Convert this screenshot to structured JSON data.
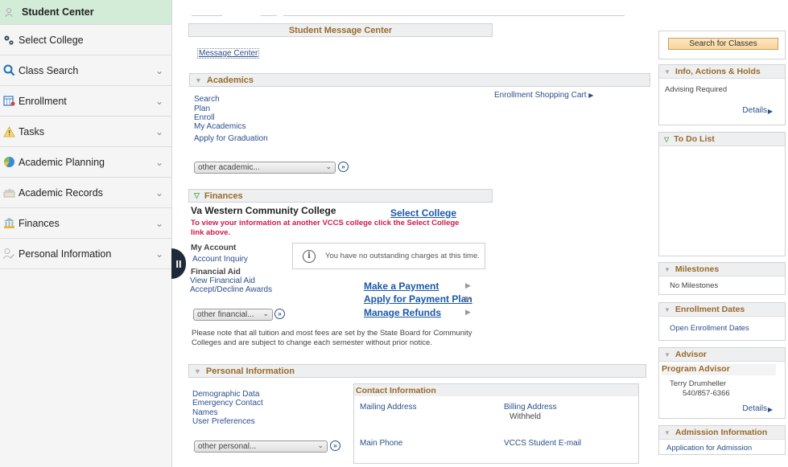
{
  "sidebar": {
    "items": [
      {
        "label": "Student Center",
        "icon": "person-icon",
        "active": true
      },
      {
        "label": "Select College",
        "icon": "gears-icon"
      },
      {
        "label": "Class Search",
        "icon": "search-icon",
        "expandable": true
      },
      {
        "label": "Enrollment",
        "icon": "calendar-icon",
        "expandable": true
      },
      {
        "label": "Tasks",
        "icon": "warning-icon",
        "expandable": true
      },
      {
        "label": "Academic Planning",
        "icon": "globe-icon",
        "expandable": true
      },
      {
        "label": "Academic Records",
        "icon": "records-icon",
        "expandable": true
      },
      {
        "label": "Finances",
        "icon": "bank-icon",
        "expandable": true
      },
      {
        "label": "Personal Information",
        "icon": "user-edit-icon",
        "expandable": true
      }
    ],
    "collapse_handle": "II"
  },
  "message_center": {
    "header": "Student Message Center",
    "link": "Message Center"
  },
  "academics": {
    "header": "Academics",
    "links": [
      "Search",
      "Plan",
      "Enroll",
      "My Academics",
      "Apply for Graduation"
    ],
    "shopping_cart": "Enrollment Shopping Cart",
    "dropdown": "other academic..."
  },
  "finances": {
    "header": "Finances",
    "college": "Va Western Community College",
    "select_college": "Select College",
    "warning": "To view your information at another VCCS college click the Select College link above.",
    "my_account_label": "My Account",
    "account_inquiry": "Account Inquiry",
    "financial_aid_label": "Financial Aid",
    "view_financial_aid": "View Financial Aid",
    "accept_decline": "Accept/Decline Awards",
    "notice": "You have no outstanding charges at this time.",
    "actions": [
      "Make a Payment",
      "Apply for Payment Plan",
      "Manage Refunds"
    ],
    "dropdown": "other financial...",
    "footnote": "Please note that all tuition and most fees are set by the State Board for Community Colleges and are subject to change each semester without prior notice."
  },
  "personal": {
    "header": "Personal Information",
    "links": [
      "Demographic Data",
      "Emergency Contact",
      "Names",
      "User Preferences"
    ],
    "dropdown": "other personal...",
    "contact": {
      "header": "Contact Information",
      "mailing_address": "Mailing Address",
      "billing_address": "Billing Address",
      "billing_value": "Withheld",
      "main_phone": "Main Phone",
      "student_email": "VCCS Student E-mail"
    }
  },
  "right_panel": {
    "search_button": "Search for Classes",
    "holds": {
      "header": "Info, Actions & Holds",
      "item": "Advising Required",
      "details": "Details"
    },
    "todo": {
      "header": "To Do List"
    },
    "milestones": {
      "header": "Milestones",
      "item": "No Milestones"
    },
    "enrollment_dates": {
      "header": "Enrollment Dates",
      "link": "Open Enrollment Dates"
    },
    "advisor": {
      "header": "Advisor",
      "subheader": "Program Advisor",
      "name": "Terry Drumheller",
      "phone": "540/857-6366",
      "details": "Details"
    },
    "admission": {
      "header": "Admission Information",
      "link": "Application for Admission"
    }
  }
}
